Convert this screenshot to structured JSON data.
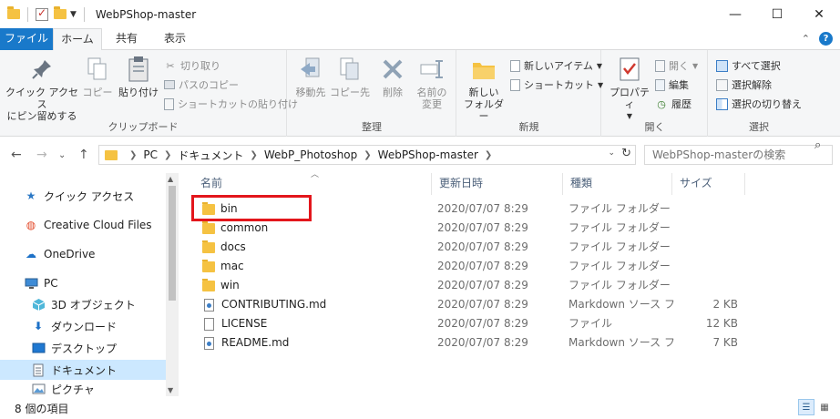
{
  "window": {
    "title": "WebPShop-master",
    "minimize_glyph": "—",
    "maximize_glyph": "☐",
    "close_glyph": "✕"
  },
  "ribbon_tabs": [
    {
      "label": "ファイル"
    },
    {
      "label": "ホーム"
    },
    {
      "label": "共有"
    },
    {
      "label": "表示"
    }
  ],
  "ribbon": {
    "clipboard": {
      "group_label": "クリップボード",
      "pin_label_1": "クイック アクセス",
      "pin_label_2": "にピン留めする",
      "copy_label": "コピー",
      "paste_label": "貼り付け",
      "cut_label": "切り取り",
      "copy_path_label": "パスのコピー",
      "paste_shortcut_label": "ショートカットの貼り付け"
    },
    "organize": {
      "group_label": "整理",
      "move_label": "移動先",
      "copyto_label": "コピー先",
      "delete_label": "削除",
      "rename_label_1": "名前の",
      "rename_label_2": "変更"
    },
    "new": {
      "group_label": "新規",
      "new_folder_label_1": "新しい",
      "new_folder_label_2": "フォルダー",
      "new_item_label": "新しいアイテム",
      "shortcut_label": "ショートカット"
    },
    "open": {
      "group_label": "開く",
      "properties_label": "プロパティ",
      "open_label": "開く",
      "edit_label": "編集",
      "history_label": "履歴"
    },
    "select": {
      "group_label": "選択",
      "select_all_label": "すべて選択",
      "select_none_label": "選択解除",
      "invert_label": "選択の切り替え"
    }
  },
  "address": {
    "crumbs": [
      "PC",
      "ドキュメント",
      "WebP_Photoshop",
      "WebPShop-master"
    ],
    "search_placeholder": "WebPShop-masterの検索"
  },
  "navigation": {
    "items": [
      {
        "label": "クイック アクセス",
        "icon": "star-icon"
      },
      {
        "label": "Creative Cloud Files",
        "icon": "creative-cloud-icon"
      },
      {
        "label": "OneDrive",
        "icon": "cloud-icon"
      },
      {
        "label": "PC",
        "icon": "computer-icon"
      },
      {
        "label": "3D オブジェクト",
        "icon": "cube-icon"
      },
      {
        "label": "ダウンロード",
        "icon": "download-icon"
      },
      {
        "label": "デスクトップ",
        "icon": "desktop-icon"
      },
      {
        "label": "ドキュメント",
        "icon": "document-icon"
      },
      {
        "label": "ピクチャ",
        "icon": "picture-icon"
      }
    ],
    "selected_index": 7
  },
  "columns": {
    "name": "名前",
    "date": "更新日時",
    "type": "種類",
    "size": "サイズ"
  },
  "files": [
    {
      "name": "bin",
      "date": "2020/07/07 8:29",
      "type": "ファイル フォルダー",
      "size": "",
      "kind": "folder"
    },
    {
      "name": "common",
      "date": "2020/07/07 8:29",
      "type": "ファイル フォルダー",
      "size": "",
      "kind": "folder"
    },
    {
      "name": "docs",
      "date": "2020/07/07 8:29",
      "type": "ファイル フォルダー",
      "size": "",
      "kind": "folder"
    },
    {
      "name": "mac",
      "date": "2020/07/07 8:29",
      "type": "ファイル フォルダー",
      "size": "",
      "kind": "folder"
    },
    {
      "name": "win",
      "date": "2020/07/07 8:29",
      "type": "ファイル フォルダー",
      "size": "",
      "kind": "folder"
    },
    {
      "name": "CONTRIBUTING.md",
      "date": "2020/07/07 8:29",
      "type": "Markdown ソース フ",
      "size": "2 KB",
      "kind": "md"
    },
    {
      "name": "LICENSE",
      "date": "2020/07/07 8:29",
      "type": "ファイル",
      "size": "12 KB",
      "kind": "file"
    },
    {
      "name": "README.md",
      "date": "2020/07/07 8:29",
      "type": "Markdown ソース フ",
      "size": "7 KB",
      "kind": "md"
    }
  ],
  "status": {
    "item_count": "8 個の項目"
  },
  "colors": {
    "file_tab": "#1979ca",
    "selection": "#cce8ff",
    "highlight_box": "#e3161c",
    "folder": "#f5c242"
  }
}
